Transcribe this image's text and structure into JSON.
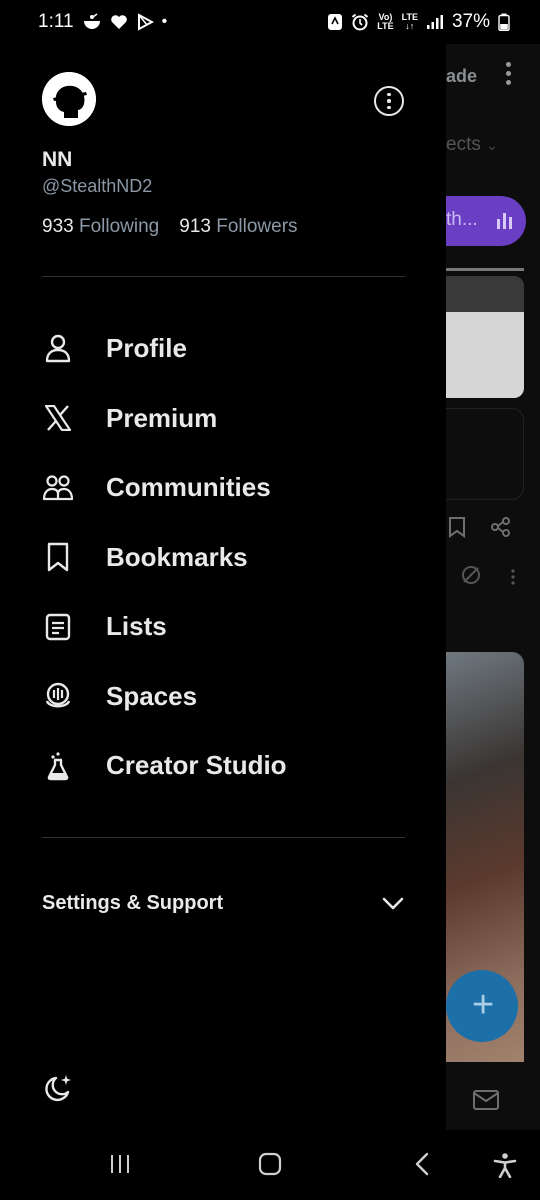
{
  "status_bar": {
    "time": "1:11",
    "dot": "•",
    "network_top": "Vo)",
    "network_bottom": "LTE",
    "lte_top": "LTE",
    "lte_bottom": "↓↑",
    "battery": "37%",
    "left_icons": [
      "notification-icon",
      "heart-icon",
      "play-icon"
    ],
    "right_icons": [
      "vpn-icon",
      "alarm-icon",
      "signal-icon",
      "battery-icon"
    ]
  },
  "background": {
    "trend_text": "ade",
    "subjects_text": "ects",
    "pill_text": "th..."
  },
  "profile": {
    "display_name": "NN",
    "handle": "@StealthND2",
    "following_count": "933",
    "following_label": "Following",
    "followers_count": "913",
    "followers_label": "Followers"
  },
  "menu": {
    "items": [
      {
        "label": "Profile",
        "icon": "person-icon"
      },
      {
        "label": "Premium",
        "icon": "x-logo-icon"
      },
      {
        "label": "Communities",
        "icon": "communities-icon"
      },
      {
        "label": "Bookmarks",
        "icon": "bookmark-icon"
      },
      {
        "label": "Lists",
        "icon": "list-icon"
      },
      {
        "label": "Spaces",
        "icon": "spaces-icon"
      },
      {
        "label": "Creator Studio",
        "icon": "flask-icon"
      }
    ]
  },
  "settings": {
    "label": "Settings & Support",
    "icon": "chevron-down-icon"
  },
  "footer": {
    "icon": "moon-sparkle-icon"
  },
  "colors": {
    "background": "#000000",
    "text_primary": "#e7e9ea",
    "text_secondary": "#8b98a5",
    "divider": "#2f3336",
    "accent_purple": "#6b3fc4",
    "fab_blue": "#1d6fa8"
  }
}
